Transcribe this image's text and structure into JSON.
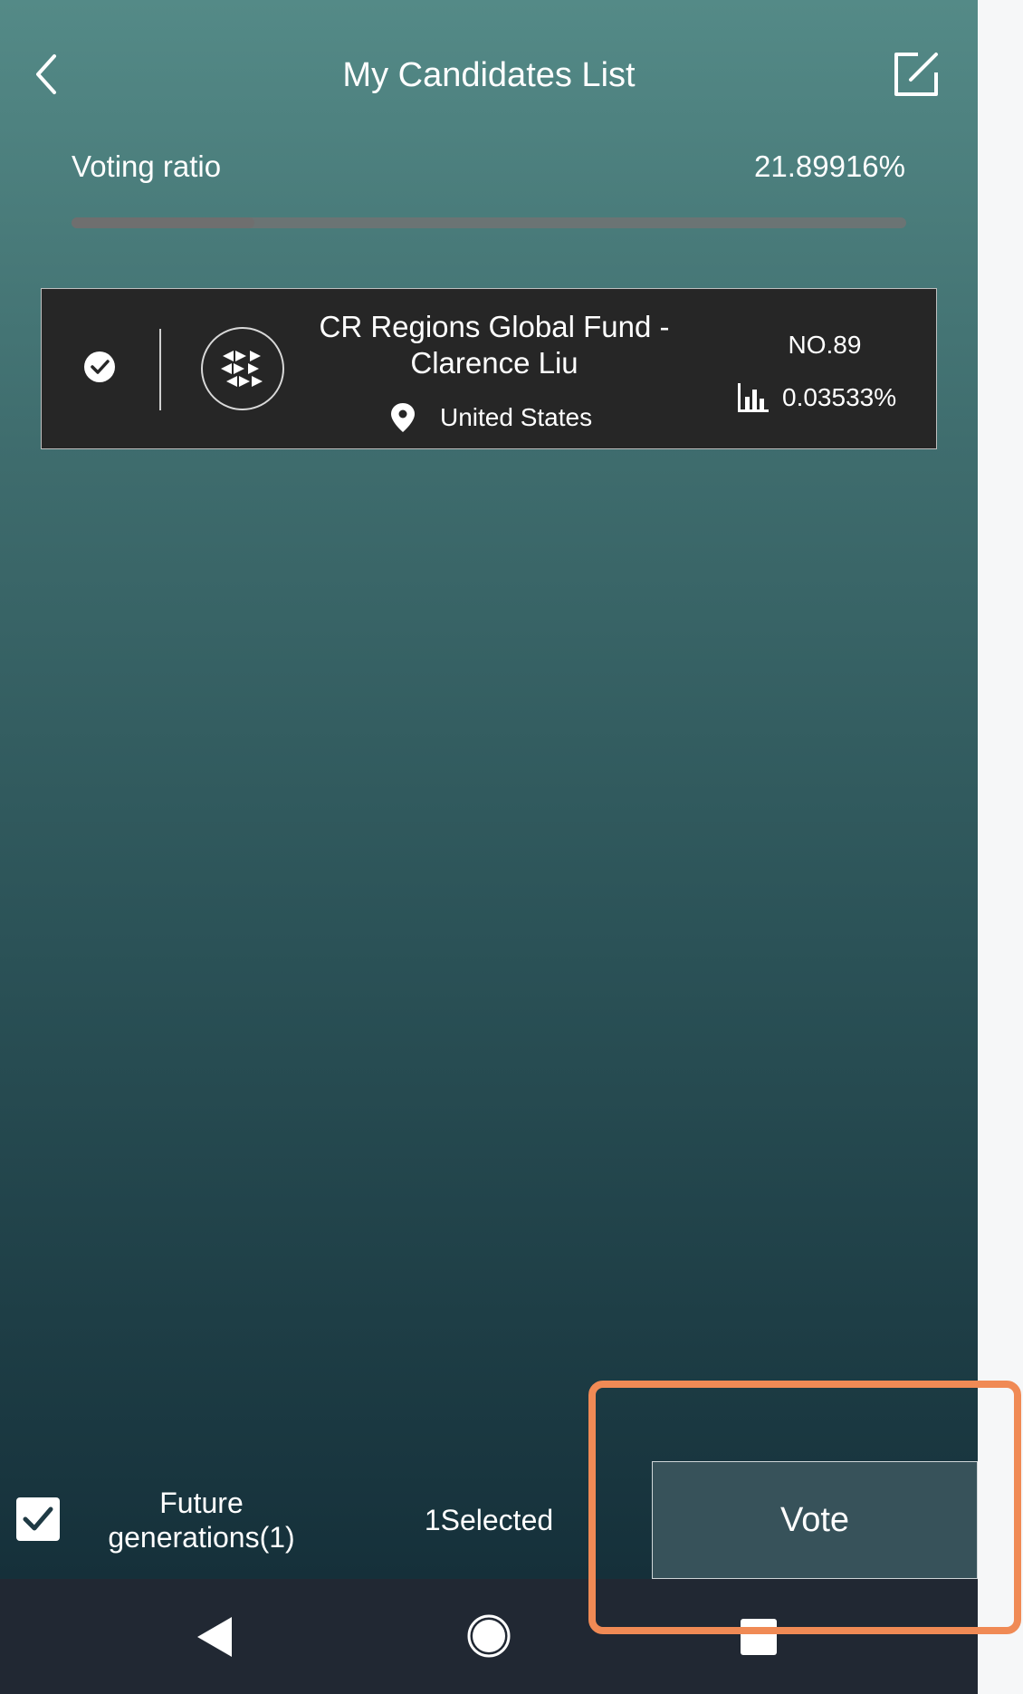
{
  "header": {
    "title": "My Candidates List",
    "back_icon": "chevron-left-icon",
    "edit_icon": "edit-icon"
  },
  "voting_ratio": {
    "label": "Voting ratio",
    "value": "21.89916%",
    "progress_fraction": 0.2189916
  },
  "candidates": [
    {
      "selected": true,
      "name": "CR Regions Global Fund - Clarence Liu",
      "location": "United States",
      "rank": "NO.89",
      "share": "0.03533%",
      "logo_icon": "candidate-logo-icon"
    }
  ],
  "footer": {
    "future_label": "Future generations(1)",
    "selected_count": "1Selected",
    "vote_label": "Vote"
  },
  "colors": {
    "highlight": "#f08a55",
    "card_bg": "#262626",
    "vote_bg": "#37525a"
  }
}
